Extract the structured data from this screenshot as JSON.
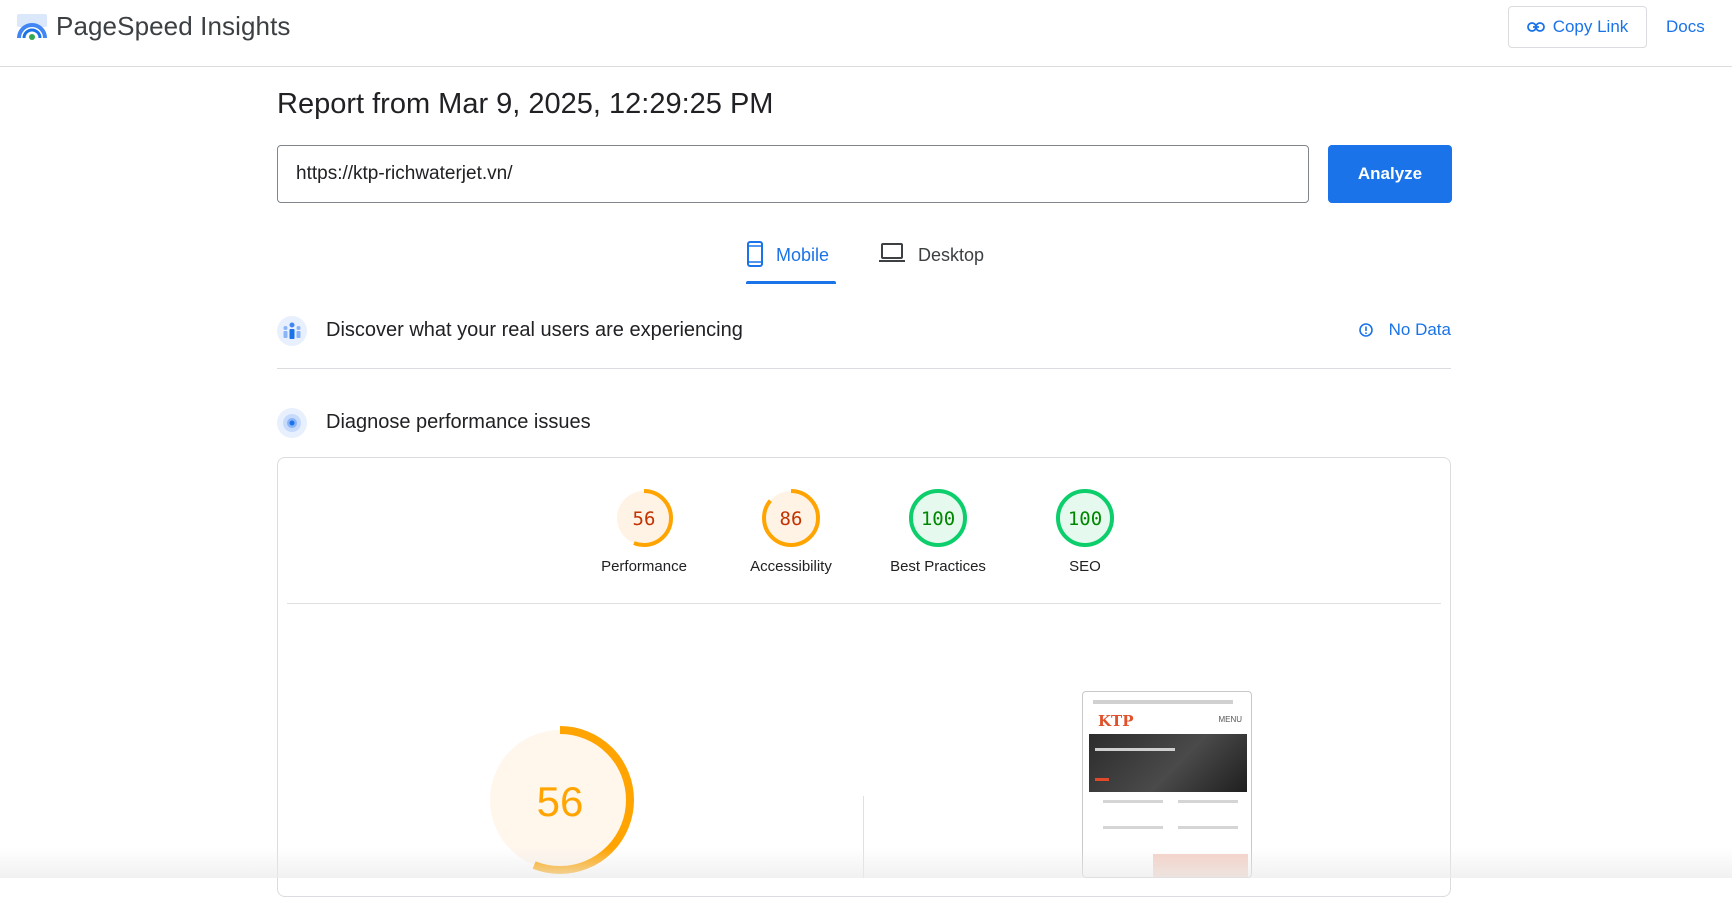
{
  "header": {
    "app_title": "PageSpeed Insights",
    "copy_link_label": "Copy Link",
    "docs_label": "Docs"
  },
  "report": {
    "title": "Report from Mar 9, 2025, 12:29:25 PM",
    "url_value": "https://ktp-richwaterjet.vn/",
    "analyze_label": "Analyze"
  },
  "tabs": {
    "mobile": "Mobile",
    "desktop": "Desktop",
    "selected": "Mobile"
  },
  "field_data": {
    "title": "Discover what your real users are experiencing",
    "status": "No Data"
  },
  "diagnose": {
    "title": "Diagnose performance issues"
  },
  "scores": [
    {
      "label": "Performance",
      "value": 56,
      "display": "56"
    },
    {
      "label": "Accessibility",
      "value": 86,
      "display": "86"
    },
    {
      "label": "Best Practices",
      "value": 100,
      "display": "100"
    },
    {
      "label": "SEO",
      "value": 100,
      "display": "100"
    }
  ],
  "main_score": {
    "value": 56,
    "display": "56"
  },
  "screenshot_preview": {
    "logo_text": "KTP",
    "menu_text": "MENU"
  },
  "colors": {
    "accent": "#1a73e8",
    "average": "#ffa400",
    "average_text": "#c33300",
    "pass": "#0cce6b",
    "pass_text": "#008800"
  }
}
